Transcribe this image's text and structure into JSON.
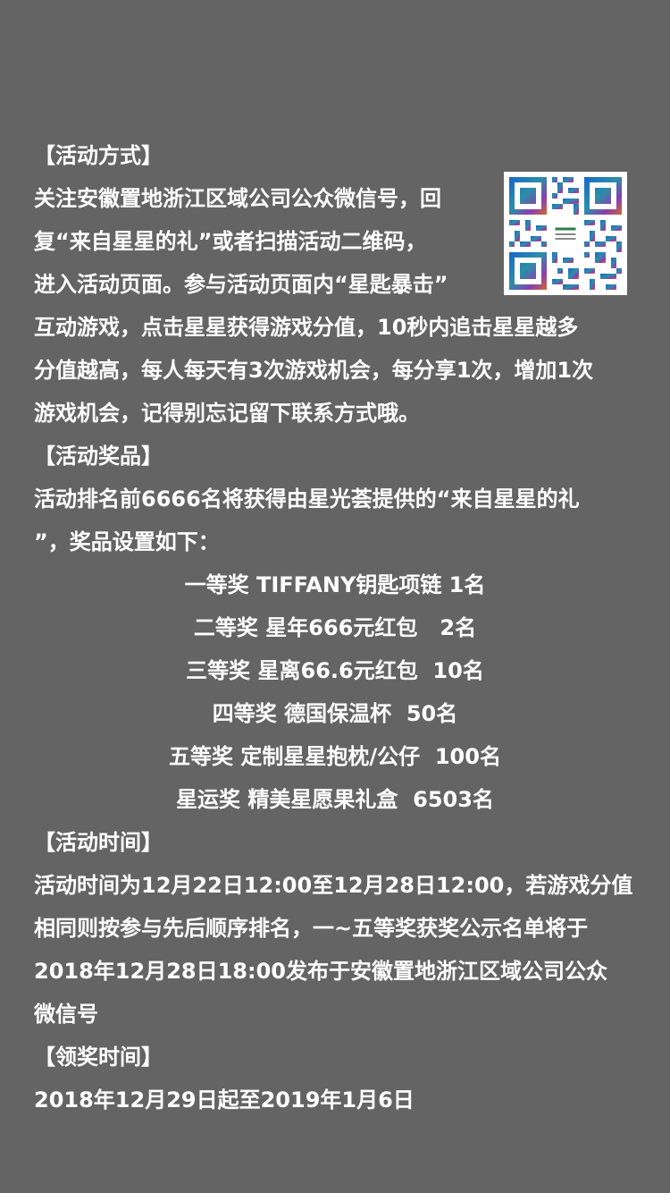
{
  "sections": {
    "method": {
      "heading": "【活动方式】",
      "lines_narrow": [
        "关注安徽置地浙江区域公司公众微信号，回",
        "复“来自星星的礼”或者扫描活动二维码，",
        "进入活动页面。参与活动页面内“星匙暴击”"
      ],
      "lines_wide": [
        "互动游戏，点击星星获得游戏分值，10秒内追击星星越多",
        "分值越高，每人每天有3次游戏机会，每分享1次，增加1次",
        "游戏机会，记得别忘记留下联系方式哦。"
      ]
    },
    "prizes": {
      "heading": "【活动奖品】",
      "intro": [
        "活动排名前6666名将获得由星光荟提供的“来自星星的礼",
        "”，奖品设置如下："
      ],
      "list": [
        "一等奖 TIFFANY钥匙项链 1名",
        "二等奖 星年666元红包   2名",
        "三等奖 星离66.6元红包  10名",
        "四等奖 德国保温杯  50名",
        "五等奖 定制星星抱枕/公仔  100名",
        "星运奖 精美星愿果礼盒  6503名"
      ]
    },
    "time": {
      "heading": "【活动时间】",
      "lines": [
        "活动时间为12月22日12:00至12月28日12:00，若游戏分值",
        "相同则按参与先后顺序排名，一~五等奖获奖公示名单将于",
        "2018年12月28日18:00发布于安徽置地浙江区域公司公众",
        "微信号"
      ]
    },
    "claim": {
      "heading": "【领奖时间】",
      "lines": [
        "2018年12月29日起至2019年1月6日"
      ]
    }
  },
  "qr_icon": "qr-code-icon",
  "colors": {
    "background": "#646464",
    "text": "#ffffff"
  }
}
